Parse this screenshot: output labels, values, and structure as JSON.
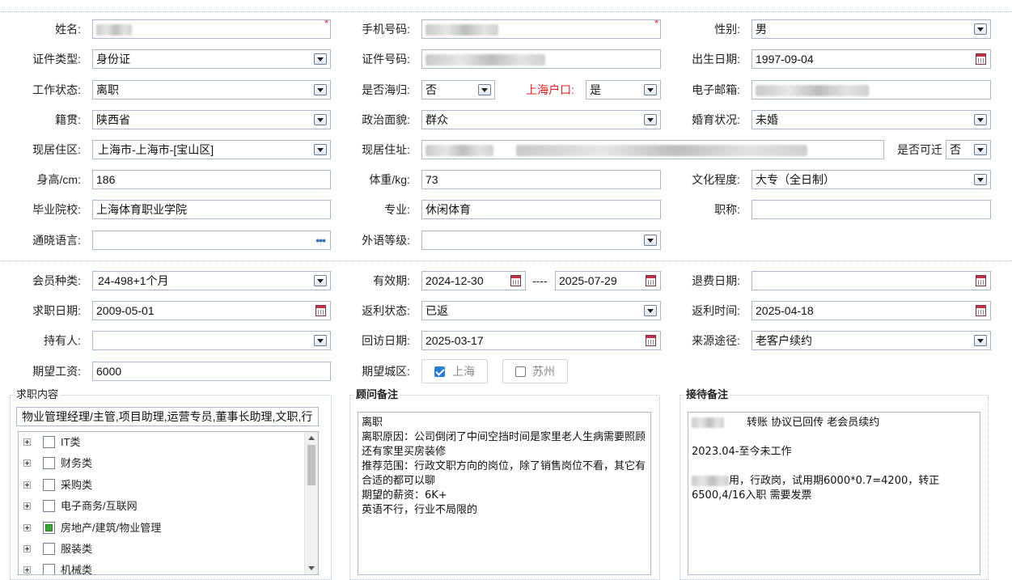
{
  "personal": {
    "name": {
      "label": "姓名:"
    },
    "phone": {
      "label": "手机号码:"
    },
    "gender": {
      "label": "性别:",
      "value": "男"
    },
    "id_type": {
      "label": "证件类型:",
      "value": "身份证"
    },
    "id_number": {
      "label": "证件号码:"
    },
    "birth_date": {
      "label": "出生日期:",
      "value": "1997-09-04"
    },
    "work_status": {
      "label": "工作状态:",
      "value": "离职"
    },
    "returnee": {
      "label": "是否海归:",
      "value": "否"
    },
    "sh_hukou": {
      "label": "上海户口:",
      "value": "是"
    },
    "email": {
      "label": "电子邮箱:"
    },
    "native_place": {
      "label": "籍贯:",
      "value": "陕西省"
    },
    "political": {
      "label": "政治面貌:",
      "value": "群众"
    },
    "marital": {
      "label": "婚育状况:",
      "value": "未婚"
    },
    "residence_area": {
      "label": "现居住区:",
      "value": "上海市-上海市-[宝山区]"
    },
    "residence_addr": {
      "label": "现居住址:"
    },
    "relocatable": {
      "label": "是否可迁",
      "value": "否"
    },
    "height": {
      "label": "身高/cm:",
      "value": "186"
    },
    "weight": {
      "label": "体重/kg:",
      "value": "73"
    },
    "education": {
      "label": "文化程度:",
      "value": "大专（全日制）"
    },
    "school": {
      "label": "毕业院校:",
      "value": "上海体育职业学院"
    },
    "major": {
      "label": "专业:",
      "value": "休闲体育"
    },
    "title": {
      "label": "职称:",
      "value": ""
    },
    "languages": {
      "label": "通晓语言:",
      "value": "",
      "more": "•••"
    },
    "foreign_level": {
      "label": "外语等级:",
      "value": ""
    }
  },
  "membership": {
    "member_type": {
      "label": "会员种类:",
      "value": "24-498+1个月"
    },
    "validity": {
      "label": "有效期:",
      "from": "2024-12-30",
      "sep": "----",
      "to": "2025-07-29"
    },
    "refund_date": {
      "label": "退费日期:",
      "value": ""
    },
    "job_date": {
      "label": "求职日期:",
      "value": "2009-05-01"
    },
    "rebate_status": {
      "label": "返利状态:",
      "value": "已返"
    },
    "rebate_time": {
      "label": "返利时间:",
      "value": "2025-04-18"
    },
    "holder": {
      "label": "持有人:",
      "value": ""
    },
    "visit_date": {
      "label": "回访日期:",
      "value": "2025-03-17"
    },
    "source": {
      "label": "来源途径:",
      "value": "老客户续约"
    },
    "salary": {
      "label": "期望工资:",
      "value": "6000"
    },
    "city": {
      "label": "期望城区:",
      "options": [
        {
          "label": "上海",
          "checked": true
        },
        {
          "label": "苏州",
          "checked": false
        }
      ]
    }
  },
  "job_content": {
    "title": "求职内容",
    "summary": "物业管理经理/主管,项目助理,运营专员,董事长助理,文职,行",
    "tree": [
      {
        "label": "IT类",
        "state": "none"
      },
      {
        "label": "财务类",
        "state": "none"
      },
      {
        "label": "采购类",
        "state": "none"
      },
      {
        "label": "电子商务/互联网",
        "state": "none"
      },
      {
        "label": "房地产/建筑/物业管理",
        "state": "partial"
      },
      {
        "label": "服装类",
        "state": "none"
      },
      {
        "label": "机械类",
        "state": "none"
      }
    ]
  },
  "advisor_notes": {
    "title": "顾问备注",
    "text": "离职\n离职原因：公司倒闭了中间空挡时间是家里老人生病需要照顾 还有家里买房装修\n推荐范围：行政文职方向的岗位，除了销售岗位不看，其它有合适的都可以聊\n期望的薪资：6K+\n英语不行，行业不局限的"
  },
  "reception_notes": {
    "title": "接待备注",
    "line1": "转账  协议已回传 老会员续约",
    "line2": "2023.04-至今未工作",
    "line3a": "用，行政岗，试用期6000*0.7=4200，转正",
    "line3b": "6500,4/16入职   需要发票"
  },
  "colors": {
    "border": "#a9b8cc",
    "required": "#e02020",
    "accent": "#2b7cd3",
    "tree_check": "#3aa83a"
  }
}
